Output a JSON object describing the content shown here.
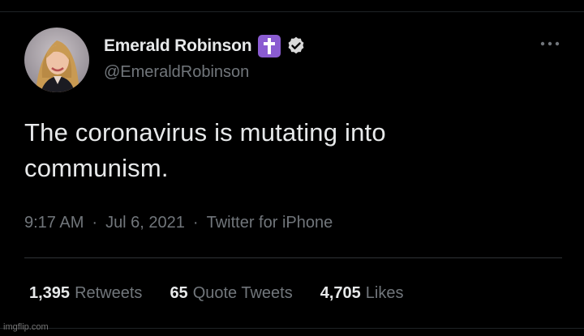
{
  "author": {
    "display_name": "Emerald Robinson",
    "handle": "@EmeraldRobinson",
    "cross_badge_color": "#8a5cd1"
  },
  "tweet": {
    "text_line1": "The coronavirus is mutating into",
    "text_line2": "communism.",
    "time": "9:17 AM",
    "date": "Jul 6, 2021",
    "source": "Twitter for iPhone",
    "separator": "·"
  },
  "stats": {
    "retweets_count": "1,395",
    "retweets_label": "Retweets",
    "quotes_count": "65",
    "quotes_label": "Quote Tweets",
    "likes_count": "4,705",
    "likes_label": "Likes"
  },
  "watermark": "imgflip.com",
  "icons": [
    "avatar",
    "cross-icon",
    "verified-icon",
    "more-icon"
  ]
}
